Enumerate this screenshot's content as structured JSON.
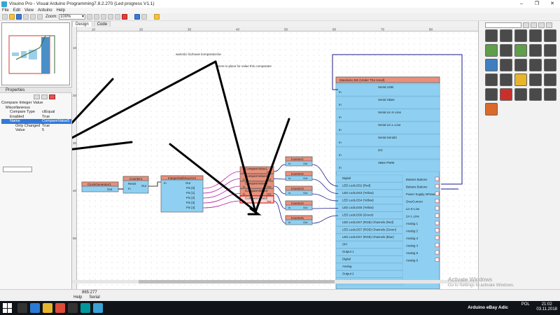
{
  "window": {
    "title": "Visuino Pro - Visual Arduino Programming7.8.2.270 (Led progress V1.1)"
  },
  "menu": [
    "File",
    "Edit",
    "View",
    "Arduino",
    "Help"
  ],
  "toolbar": {
    "zoom_label": "Zoom:",
    "zoom_value": "100%"
  },
  "tabs": [
    {
      "label": "Design"
    },
    {
      "label": "Code"
    }
  ],
  "properties": {
    "header": "Properties",
    "title": "Compare Integer Value",
    "rows": [
      {
        "key": "Miscellaneous",
        "value": ""
      },
      {
        "key": "Compare Type",
        "value": "ctEqual"
      },
      {
        "key": "Enabled",
        "value": "True"
      },
      {
        "key": "Name",
        "value": "CompareValue5"
      },
      {
        "key": "Only Changed",
        "value": "True"
      },
      {
        "key": "Value",
        "value": "5"
      }
    ]
  },
  "canvas": {
    "ruler_top": [
      "10",
      "20",
      "30",
      "40",
      "50",
      "60",
      "70",
      "80"
    ],
    "ruler_left": [
      "10",
      "20",
      "30",
      "40",
      "50"
    ],
    "annotations": [
      {
        "text": "wartości liczbowe\nkomparatorów"
      },
      {
        "text": "Here is place for\nvalue this comparator"
      }
    ],
    "components": {
      "clock": {
        "title": "ClockGenerator1",
        "out": "Out"
      },
      "counter": {
        "title": "Counter1",
        "pins": [
          "Reset",
          "In",
          "Out"
        ]
      },
      "integer_multi": {
        "title": "IntegerMultiSource1",
        "pins": [
          "In",
          "Out",
          "Pin [0]",
          "Pin [1]",
          "Pin [2]",
          "Pin [3]",
          "Pin [4]"
        ]
      },
      "compare": [
        "CompareValue1",
        "CompareValue2",
        "CompareValue3",
        "CompareValue4",
        "CompareValue5"
      ],
      "inverters": [
        "Inverter1",
        "Inverter2",
        "Inverter3",
        "Inverter4",
        "Inverter5"
      ],
      "mega": {
        "title": "Maxduino M2 (Under The Hood)",
        "sections": [
          "Serial USB",
          "Serial XBee",
          "Serial Lin K-Line",
          "Serial Lin L-Line",
          "Serial.Serial3",
          "I2C",
          "XBee PWM"
        ],
        "left_pins": [
          "Digital",
          "LED Leds.DS2 (Red)",
          "LED Leds.DS3 (Yellow)",
          "LED Leds.DS4 (Yellow)",
          "LED Leds.DS5 (Yellow)",
          "LED Leds.DS6 (Green)",
          "LED Leds.DS7 (RGB) Channels (Red)",
          "LED Leds.DS7 (RGB) Channels (Green)",
          "LED Leds.DS7 (RGB) Channels (Blue)",
          "SPI",
          "Output 1",
          "Digital",
          "Analog",
          "Output 2",
          "Digital"
        ],
        "right_pins": [
          "Buttons Buttons",
          "Buttons Buttons",
          "Power Supply IsPowered",
          "OverCurrent",
          "Lin K-Line",
          "Lin L-Line",
          "Analog 1",
          "Analog 2",
          "Analog 3",
          "Analog 4",
          "Analog 5",
          "Analog 6"
        ]
      }
    }
  },
  "status": {
    "coords": "865:277",
    "help": "Help",
    "serial": "Serial"
  },
  "watermark": {
    "line1": "Activate Windows",
    "line2": "Go to Settings to activate Windows."
  },
  "taskbar": {
    "network": "Arduino eBay Adic",
    "language": "POL",
    "time": "21:02",
    "date": "03.11.2018"
  }
}
